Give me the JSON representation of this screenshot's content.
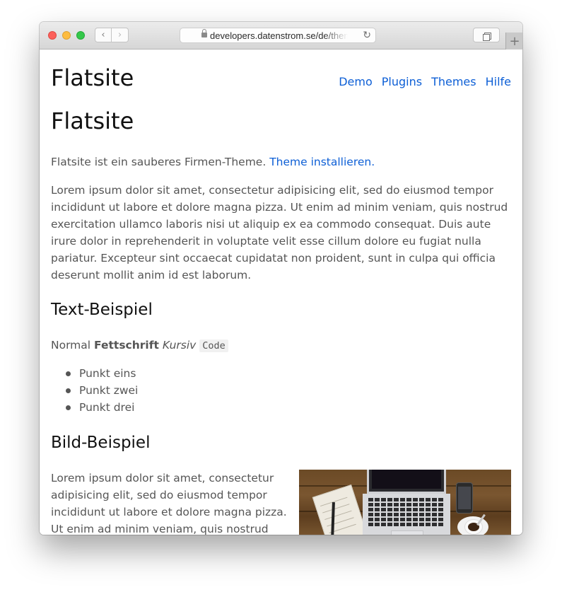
{
  "browser": {
    "url": "developers.datenstrom.se/de/theme",
    "new_tab_label": "+"
  },
  "site": {
    "name": "Flatsite",
    "nav": [
      "Demo",
      "Plugins",
      "Themes",
      "Hilfe"
    ]
  },
  "page": {
    "title": "Flatsite",
    "intro_text": "Flatsite ist ein sauberes Firmen-Theme.",
    "intro_link": "Theme installieren.",
    "lorem": "Lorem ipsum dolor sit amet, consectetur adipisicing elit, sed do eiusmod tempor incididunt ut labore et dolore magna pizza. Ut enim ad minim veniam, quis nostrud exercitation ullamco laboris nisi ut aliquip ex ea commodo consequat. Duis aute irure dolor in reprehenderit in voluptate velit esse cillum dolore eu fugiat nulla pariatur. Excepteur sint occaecat cupidatat non proident, sunt in culpa qui officia deserunt mollit anim id est laborum.",
    "text_example": {
      "heading": "Text-Beispiel",
      "normal": "Normal",
      "bold": "Fettschrift",
      "italic": "Kursiv",
      "code": "Code",
      "list": [
        "Punkt eins",
        "Punkt zwei",
        "Punkt drei"
      ]
    },
    "image_example": {
      "heading": "Bild-Beispiel",
      "text": "Lorem ipsum dolor sit amet, consectetur adipisicing elit, sed do eiusmod tempor incididunt ut labore et dolore magna pizza. Ut enim ad minim veniam, quis nostrud"
    }
  },
  "icons": {
    "back": "chevron-left-icon",
    "forward": "chevron-right-icon",
    "lock": "lock-icon",
    "reload": "reload-icon",
    "tabs": "tab-overview-icon"
  },
  "colors": {
    "link": "#0d5fd6",
    "text": "#555555",
    "heading": "#111111"
  }
}
